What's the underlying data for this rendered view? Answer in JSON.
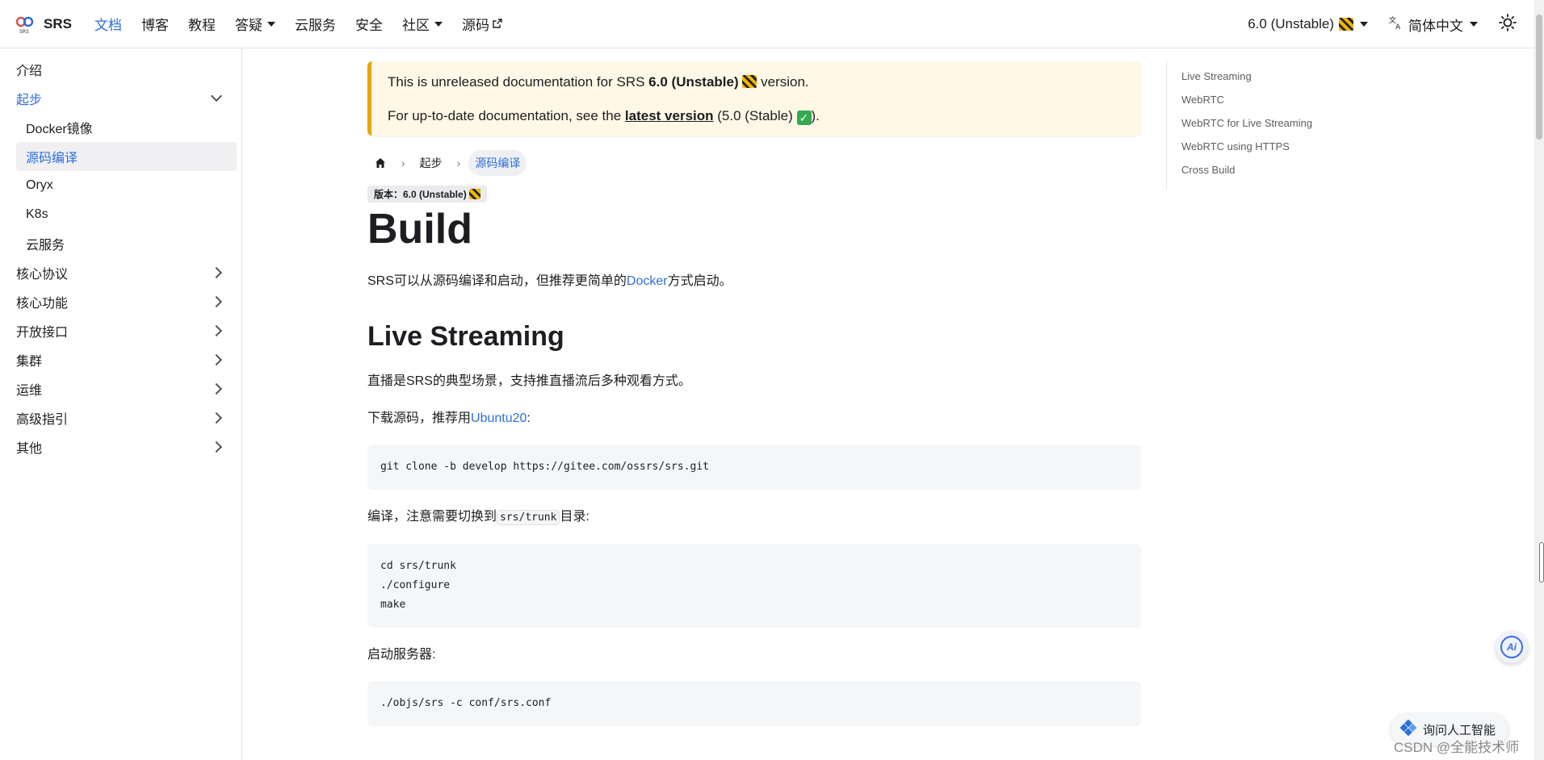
{
  "navbar": {
    "brand": "SRS",
    "links": [
      {
        "label": "文档",
        "active": true,
        "dropdown": false,
        "external": false
      },
      {
        "label": "博客",
        "active": false,
        "dropdown": false,
        "external": false
      },
      {
        "label": "教程",
        "active": false,
        "dropdown": false,
        "external": false
      },
      {
        "label": "答疑",
        "active": false,
        "dropdown": true,
        "external": false
      },
      {
        "label": "云服务",
        "active": false,
        "dropdown": false,
        "external": false
      },
      {
        "label": "安全",
        "active": false,
        "dropdown": false,
        "external": false
      },
      {
        "label": "社区",
        "active": false,
        "dropdown": true,
        "external": false
      },
      {
        "label": "源码",
        "active": false,
        "dropdown": false,
        "external": true
      }
    ],
    "version_label": "6.0 (Unstable)",
    "language_label": "简体中文",
    "accent_color": "#2e6fd9"
  },
  "sidebar": {
    "items": [
      {
        "label": "介绍",
        "type": "top",
        "chevron": "none",
        "active": false
      },
      {
        "label": "起步",
        "type": "top",
        "chevron": "down",
        "active": true
      },
      {
        "label": "Docker镜像",
        "type": "sub",
        "chevron": "none",
        "active": false
      },
      {
        "label": "源码编译",
        "type": "sub",
        "chevron": "none",
        "active": true
      },
      {
        "label": "Oryx",
        "type": "sub",
        "chevron": "none",
        "active": false
      },
      {
        "label": "K8s",
        "type": "sub",
        "chevron": "none",
        "active": false
      },
      {
        "label": "云服务",
        "type": "sub",
        "chevron": "none",
        "active": false
      },
      {
        "label": "核心协议",
        "type": "top",
        "chevron": "right",
        "active": false
      },
      {
        "label": "核心功能",
        "type": "top",
        "chevron": "right",
        "active": false
      },
      {
        "label": "开放接口",
        "type": "top",
        "chevron": "right",
        "active": false
      },
      {
        "label": "集群",
        "type": "top",
        "chevron": "right",
        "active": false
      },
      {
        "label": "运维",
        "type": "top",
        "chevron": "right",
        "active": false
      },
      {
        "label": "高级指引",
        "type": "top",
        "chevron": "right",
        "active": false
      },
      {
        "label": "其他",
        "type": "top",
        "chevron": "right",
        "active": false
      }
    ]
  },
  "notice": {
    "line1_prefix": "This is unreleased documentation for SRS ",
    "line1_version": "6.0 (Unstable)",
    "line1_suffix": " version.",
    "line2_prefix": "For up-to-date documentation, see the ",
    "line2_link": "latest version",
    "line2_middle": " (5.0 (Stable) ",
    "line2_suffix": ").",
    "border_color": "#e6a700",
    "background_color": "#fff8e6"
  },
  "breadcrumb": {
    "items": [
      "起步",
      "源码编译"
    ]
  },
  "version_badge": "版本：6.0 (Unstable)",
  "page_title": "Build",
  "intro": {
    "prefix": "SRS可以从源码编译和启动，但推荐更简单的",
    "link": "Docker",
    "suffix": "方式启动。"
  },
  "section_live": {
    "title": "Live Streaming",
    "desc": "直播是SRS的典型场景，支持推直播流后多种观看方式。",
    "download_prefix": "下载源码，推荐用",
    "download_link": "Ubuntu20",
    "download_suffix": ":",
    "code1": "git clone -b develop https://gitee.com/ossrs/srs.git",
    "compile_prefix": "编译，注意需要切换到",
    "compile_code": "srs/trunk",
    "compile_suffix": "目录:",
    "code2": [
      "cd srs/trunk",
      "./configure",
      "make"
    ],
    "start_label": "启动服务器:",
    "code3": "./objs/srs -c conf/srs.conf"
  },
  "toc": {
    "items": [
      "Live Streaming",
      "WebRTC",
      "WebRTC for Live Streaming",
      "WebRTC using HTTPS",
      "Cross Build"
    ]
  },
  "floating": {
    "ai_label": "Ai",
    "ask_label": "询问人工智能",
    "watermark": "CSDN @全能技术师"
  }
}
